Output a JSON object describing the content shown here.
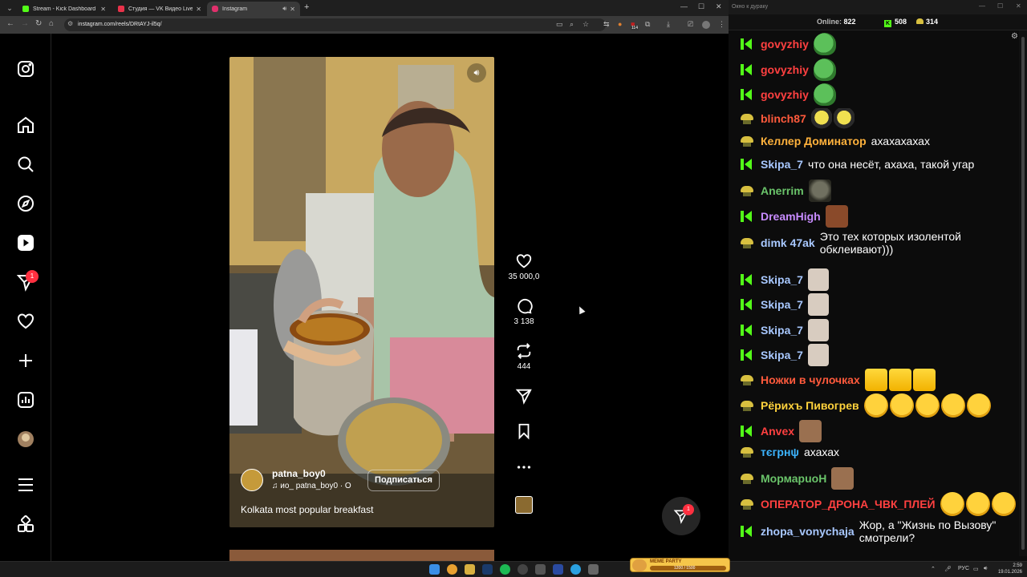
{
  "browser": {
    "tabs": [
      {
        "label": "Stream - Kick Dashboard",
        "favicon_color": "#53fc18",
        "active": false
      },
      {
        "label": "Студия — VK Видео Live",
        "favicon_color": "#e8324a",
        "active": false
      },
      {
        "label": "Instagram",
        "favicon_color": "#e1306c",
        "active": true
      }
    ],
    "url": "instagram.com/reels/DRtAYJ-il5q/",
    "extension_badge": "114"
  },
  "instagram": {
    "sidebar_badge": "1",
    "reel": {
      "username": "patna_boy0",
      "audio": "♫  ио_ patna_boy0 · О",
      "follow_label": "Подписаться",
      "caption": "Kolkata most popular breakfast"
    },
    "actions": {
      "likes": "35 000,0",
      "comments": "3 138",
      "reposts": "444"
    },
    "messages_badge": "1"
  },
  "chat": {
    "title": "Окно к дураку",
    "online_label": "Online:",
    "online_count": "822",
    "kick_count": "508",
    "sponsor_count": "314",
    "messages": [
      {
        "badge": "kick",
        "user": "govyzhiy",
        "color": "#ff4040",
        "text": "",
        "emotes": [
          "pepe"
        ]
      },
      {
        "badge": "kick",
        "user": "govyzhiy",
        "color": "#ff4040",
        "text": "",
        "emotes": [
          "pepe"
        ]
      },
      {
        "badge": "kick",
        "user": "govyzhiy",
        "color": "#ff4040",
        "text": "",
        "emotes": [
          "pepe"
        ]
      },
      {
        "badge": "sponsor",
        "user": "blinch87",
        "color": "#ff5a3c",
        "text": "",
        "emotes": [
          "blob",
          "blob"
        ]
      },
      {
        "badge": "sponsor",
        "user": "Келлер Доминатор",
        "color": "#ffb23c",
        "text": "ахахахахах",
        "emotes": []
      },
      {
        "badge": "kick",
        "user": "Skipa_7",
        "color": "#a8c8ff",
        "text": "что она несёт, ахаха, такой угар",
        "emotes": []
      },
      {
        "badge": "sponsor",
        "user": "Anerrim",
        "color": "#6ac46a",
        "text": "",
        "emotes": [
          "cat"
        ]
      },
      {
        "badge": "kick",
        "user": "DreamHigh",
        "color": "#c88cff",
        "text": "",
        "emotes": [
          "face"
        ]
      },
      {
        "badge": "sponsor",
        "user": "dimk 47ak",
        "color": "#a8c8ff",
        "text": "Это тех которых изолентой обклеивают)))",
        "emotes": []
      },
      {
        "badge": "kick",
        "user": "Skipa_7",
        "color": "#a8c8ff",
        "text": "",
        "emotes": [
          "pale"
        ]
      },
      {
        "badge": "kick",
        "user": "Skipa_7",
        "color": "#a8c8ff",
        "text": "",
        "emotes": [
          "pale"
        ]
      },
      {
        "badge": "kick",
        "user": "Skipa_7",
        "color": "#a8c8ff",
        "text": "",
        "emotes": [
          "pale"
        ]
      },
      {
        "badge": "kick",
        "user": "Skipa_7",
        "color": "#a8c8ff",
        "text": "",
        "emotes": [
          "pale"
        ]
      },
      {
        "badge": "sponsor",
        "user": "Ножки в чулочках",
        "color": "#ff5a3c",
        "text": "",
        "emotes": [
          "xd",
          "xd",
          "xd"
        ]
      },
      {
        "badge": "sponsor",
        "user": "Рёрихъ Пивогрев",
        "color": "#ffd23c",
        "text": "",
        "emotes": [
          "rofl",
          "rofl",
          "rofl",
          "rofl",
          "rofl"
        ]
      },
      {
        "badge": "kick",
        "user": "Anvex",
        "color": "#ff4040",
        "text": "",
        "emotes": [
          "man"
        ]
      },
      {
        "badge": "sponsor",
        "user": "тєгрнψ",
        "color": "#3cb4ff",
        "text": "ахахах",
        "emotes": []
      },
      {
        "badge": "sponsor",
        "user": "МормарuoH",
        "color": "#6ac46a",
        "text": "",
        "emotes": [
          "man"
        ]
      },
      {
        "badge": "sponsor",
        "user": "ОПЕРАТОР_ДРОНА_ЧВК_ПЛЕЙ",
        "color": "#ff4040",
        "text": "",
        "emotes": [
          "rofl",
          "rofl",
          "rofl"
        ]
      },
      {
        "badge": "kick",
        "user": "zhopa_vonychaja",
        "color": "#a8c8ff",
        "text": "Жор, а \"Жизнь по Вызову\" смотрели?",
        "emotes": []
      }
    ]
  },
  "taskbar": {
    "meme_title": "MEME PARTY",
    "meme_progress": "1200 / 1500",
    "lang": "РУС",
    "time": "2:59",
    "date": "19.01.2026"
  }
}
